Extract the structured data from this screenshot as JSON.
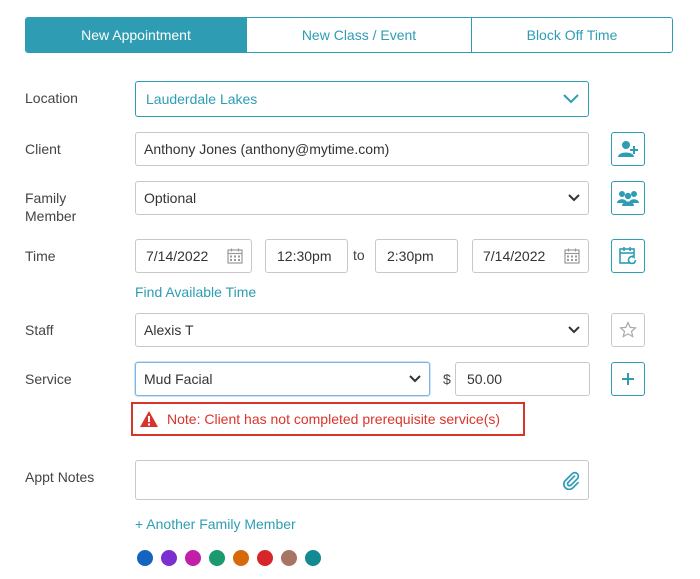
{
  "tabs": [
    {
      "label": "New Appointment",
      "active": true
    },
    {
      "label": "New Class / Event",
      "active": false
    },
    {
      "label": "Block Off Time",
      "active": false
    }
  ],
  "labels": {
    "location": "Location",
    "client": "Client",
    "family_member": "Family Member",
    "time": "Time",
    "staff": "Staff",
    "service": "Service",
    "appt_notes": "Appt Notes"
  },
  "location": {
    "value": "Lauderdale Lakes"
  },
  "client": {
    "value": "Anthony Jones (anthony@mytime.com)"
  },
  "family_member": {
    "value": "Optional"
  },
  "time": {
    "start_date": "7/14/2022",
    "start_time": "12:30pm",
    "separator": "to",
    "end_time": "2:30pm",
    "end_date": "7/14/2022"
  },
  "find_time_link": "Find Available Time",
  "staff": {
    "value": "Alexis T"
  },
  "service": {
    "value": "Mud Facial",
    "currency": "$",
    "price": "50.00"
  },
  "warning": "Note: Client has not completed prerequisite service(s)",
  "notes": {
    "value": ""
  },
  "add_family_link": "+ Another Family Member",
  "colors": {
    "accent": "#2e9db4",
    "warning": "#d9342b",
    "swatches": [
      "#1565c0",
      "#7b2fd0",
      "#c21fa8",
      "#1a9a6e",
      "#d66a0a",
      "#d7262a",
      "#a87565",
      "#138a91"
    ]
  }
}
